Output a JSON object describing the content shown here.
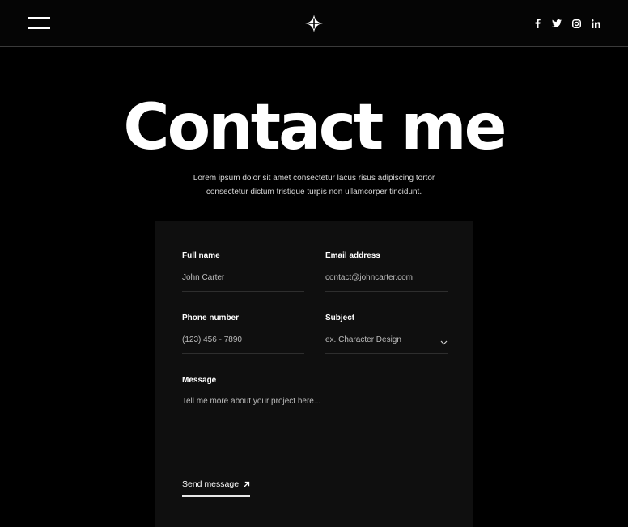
{
  "header": {
    "menu_icon": "hamburger-menu-icon",
    "logo_icon": "four-point-star-logo-icon",
    "socials": [
      {
        "icon": "facebook-icon"
      },
      {
        "icon": "twitter-icon"
      },
      {
        "icon": "instagram-icon"
      },
      {
        "icon": "linkedin-icon"
      }
    ]
  },
  "hero": {
    "title": "Contact me",
    "subtitle_line1": "Lorem ipsum dolor sit amet consectetur lacus risus adipiscing tortor",
    "subtitle_line2": "consectetur dictum tristique turpis non ullamcorper tincidunt."
  },
  "form": {
    "full_name": {
      "label": "Full name",
      "placeholder": "John Carter"
    },
    "email": {
      "label": "Email address",
      "placeholder": "contact@johncarter.com"
    },
    "phone": {
      "label": "Phone number",
      "placeholder": "(123) 456 - 7890"
    },
    "subject": {
      "label": "Subject",
      "placeholder": "ex. Character Design"
    },
    "message": {
      "label": "Message",
      "placeholder": "Tell me more about your project here..."
    },
    "send_label": "Send message"
  },
  "colors": {
    "background": "#000000",
    "header": "#050505",
    "card": "#0f0f0f",
    "text": "#ffffff",
    "divider": "#2e2e2e"
  }
}
